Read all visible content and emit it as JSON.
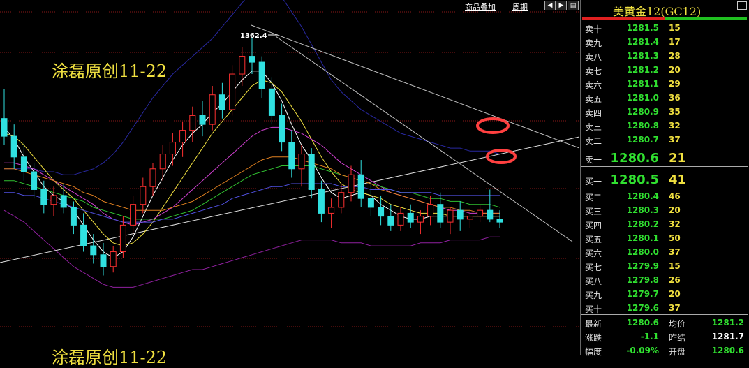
{
  "toolbar": {
    "overlay_label": "商品叠加",
    "period_label": "周期"
  },
  "watermark": {
    "top": "涂磊原创11-22",
    "bottom": "涂磊原创11-22"
  },
  "panel": {
    "title": "美黄金12(GC12)",
    "sell": [
      {
        "label": "卖十",
        "price": "1281.5",
        "qty": "15"
      },
      {
        "label": "卖九",
        "price": "1281.4",
        "qty": "17"
      },
      {
        "label": "卖八",
        "price": "1281.3",
        "qty": "28"
      },
      {
        "label": "卖七",
        "price": "1281.2",
        "qty": "20"
      },
      {
        "label": "卖六",
        "price": "1281.1",
        "qty": "29"
      },
      {
        "label": "卖五",
        "price": "1281.0",
        "qty": "36"
      },
      {
        "label": "卖四",
        "price": "1280.9",
        "qty": "35"
      },
      {
        "label": "卖三",
        "price": "1280.8",
        "qty": "32"
      },
      {
        "label": "卖二",
        "price": "1280.7",
        "qty": "37"
      },
      {
        "label": "卖一",
        "price": "1280.6",
        "qty": "21"
      }
    ],
    "buy": [
      {
        "label": "买一",
        "price": "1280.5",
        "qty": "41"
      },
      {
        "label": "买二",
        "price": "1280.4",
        "qty": "46"
      },
      {
        "label": "买三",
        "price": "1280.3",
        "qty": "20"
      },
      {
        "label": "买四",
        "price": "1280.2",
        "qty": "32"
      },
      {
        "label": "买五",
        "price": "1280.1",
        "qty": "50"
      },
      {
        "label": "买六",
        "price": "1280.0",
        "qty": "37"
      },
      {
        "label": "买七",
        "price": "1279.9",
        "qty": "15"
      },
      {
        "label": "买八",
        "price": "1279.8",
        "qty": "26"
      },
      {
        "label": "买九",
        "price": "1279.7",
        "qty": "20"
      },
      {
        "label": "买十",
        "price": "1279.6",
        "qty": "37"
      }
    ],
    "stats": {
      "latest_label": "最新",
      "latest": "1280.6",
      "avg_label": "均价",
      "avg": "1281.2",
      "change_label": "涨跌",
      "change": "-1.1",
      "prev_label": "昨结",
      "prev": "1281.7",
      "pct_label": "幅度",
      "pct": "-0.09%",
      "open_label": "开盘",
      "open": "1280.6"
    },
    "colors": {
      "price": "#30e030",
      "qty": "#f0e040",
      "neutral": "#ffffff"
    }
  },
  "chart_data": {
    "type": "line",
    "candles": [
      [
        1335,
        1345,
        1326,
        1329
      ],
      [
        1329,
        1333,
        1318,
        1322
      ],
      [
        1322,
        1327,
        1314,
        1317
      ],
      [
        1317,
        1320,
        1308,
        1311
      ],
      [
        1311,
        1314,
        1303,
        1306
      ],
      [
        1306,
        1312,
        1302,
        1309
      ],
      [
        1309,
        1313,
        1303,
        1305
      ],
      [
        1305,
        1307,
        1296,
        1299
      ],
      [
        1299,
        1303,
        1290,
        1292
      ],
      [
        1292,
        1296,
        1286,
        1289
      ],
      [
        1289,
        1293,
        1282,
        1285
      ],
      [
        1285,
        1292,
        1283,
        1290
      ],
      [
        1290,
        1302,
        1288,
        1299
      ],
      [
        1299,
        1309,
        1296,
        1306
      ],
      [
        1306,
        1315,
        1303,
        1312
      ],
      [
        1312,
        1320,
        1309,
        1318
      ],
      [
        1318,
        1326,
        1314,
        1323
      ],
      [
        1323,
        1330,
        1319,
        1327
      ],
      [
        1327,
        1334,
        1322,
        1331
      ],
      [
        1331,
        1339,
        1327,
        1336
      ],
      [
        1336,
        1341,
        1329,
        1333
      ],
      [
        1333,
        1346,
        1331,
        1343
      ],
      [
        1343,
        1347,
        1335,
        1338
      ],
      [
        1338,
        1353,
        1336,
        1350
      ],
      [
        1350,
        1359,
        1346,
        1356
      ],
      [
        1356,
        1362.4,
        1350,
        1354
      ],
      [
        1354,
        1356,
        1342,
        1345
      ],
      [
        1345,
        1349,
        1333,
        1336
      ],
      [
        1336,
        1340,
        1324,
        1327
      ],
      [
        1327,
        1331,
        1315,
        1318
      ],
      [
        1318,
        1326,
        1312,
        1323
      ],
      [
        1323,
        1325,
        1308,
        1311
      ],
      [
        1311,
        1314,
        1300,
        1303
      ],
      [
        1303,
        1308,
        1298,
        1305
      ],
      [
        1305,
        1313,
        1303,
        1310
      ],
      [
        1310,
        1319,
        1307,
        1316
      ],
      [
        1316,
        1321,
        1305,
        1308
      ],
      [
        1308,
        1313,
        1302,
        1305
      ],
      [
        1305,
        1309,
        1299,
        1302
      ],
      [
        1302,
        1306,
        1297,
        1299
      ],
      [
        1299,
        1305,
        1297,
        1303
      ],
      [
        1303,
        1306,
        1298,
        1300
      ],
      [
        1300,
        1304,
        1296,
        1302
      ],
      [
        1302,
        1309,
        1299,
        1306
      ],
      [
        1306,
        1310,
        1298,
        1300
      ],
      [
        1300,
        1305,
        1296,
        1304
      ],
      [
        1304,
        1307,
        1297,
        1301
      ],
      [
        1301,
        1304,
        1298,
        1302
      ],
      [
        1302,
        1306,
        1300,
        1304
      ],
      [
        1304,
        1311,
        1300,
        1301
      ],
      [
        1301,
        1304,
        1298,
        1300
      ]
    ],
    "ma_lines": [
      {
        "color": "#ffffff",
        "values": [
          1332,
          1328,
          1322,
          1317,
          1312,
          1309,
          1307,
          1304,
          1299,
          1294,
          1290,
          1288,
          1290,
          1295,
          1302,
          1309,
          1315,
          1321,
          1326,
          1330,
          1333,
          1337,
          1340,
          1344,
          1348,
          1351,
          1351,
          1347,
          1341,
          1333,
          1326,
          1321,
          1315,
          1310,
          1308,
          1309,
          1310,
          1309,
          1306,
          1304,
          1302,
          1301,
          1301,
          1302,
          1302,
          1302,
          1302,
          1302,
          1302,
          1302,
          1302
        ]
      },
      {
        "color": "#f0e040",
        "values": [
          1330,
          1329,
          1326,
          1322,
          1318,
          1314,
          1311,
          1308,
          1304,
          1300,
          1296,
          1293,
          1292,
          1293,
          1296,
          1300,
          1305,
          1310,
          1315,
          1320,
          1325,
          1330,
          1334,
          1338,
          1342,
          1346,
          1348,
          1347,
          1344,
          1339,
          1334,
          1328,
          1322,
          1317,
          1313,
          1311,
          1310,
          1309,
          1308,
          1306,
          1305,
          1304,
          1303,
          1303,
          1303,
          1302,
          1302,
          1302,
          1302,
          1302,
          1302
        ]
      },
      {
        "color": "#d040d0",
        "values": [
          1320,
          1320,
          1319,
          1318,
          1316,
          1314,
          1312,
          1310,
          1308,
          1306,
          1303,
          1301,
          1300,
          1299,
          1300,
          1301,
          1303,
          1305,
          1308,
          1311,
          1314,
          1317,
          1320,
          1323,
          1326,
          1329,
          1331,
          1332,
          1332,
          1331,
          1330,
          1328,
          1326,
          1323,
          1320,
          1318,
          1316,
          1314,
          1312,
          1310,
          1309,
          1308,
          1307,
          1306,
          1305,
          1304,
          1304,
          1303,
          1303,
          1303,
          1303
        ]
      },
      {
        "color": "#30c030",
        "values": [
          1314,
          1314,
          1313,
          1312,
          1311,
          1310,
          1309,
          1308,
          1307,
          1305,
          1304,
          1303,
          1302,
          1301,
          1301,
          1301,
          1301,
          1302,
          1303,
          1304,
          1306,
          1308,
          1310,
          1312,
          1314,
          1316,
          1317,
          1318,
          1319,
          1319,
          1319,
          1319,
          1318,
          1317,
          1316,
          1315,
          1314,
          1313,
          1312,
          1311,
          1310,
          1310,
          1309,
          1308,
          1308,
          1307,
          1307,
          1306,
          1306,
          1306,
          1305
        ]
      },
      {
        "color": "#e08020",
        "values": [
          1318,
          1318,
          1317,
          1316,
          1315,
          1314,
          1313,
          1312,
          1310,
          1309,
          1307,
          1306,
          1305,
          1304,
          1304,
          1304,
          1304,
          1305,
          1306,
          1307,
          1309,
          1311,
          1313,
          1315,
          1317,
          1319,
          1321,
          1322,
          1322,
          1322,
          1321,
          1320,
          1319,
          1318,
          1316,
          1315,
          1314,
          1313,
          1311,
          1310,
          1309,
          1308,
          1307,
          1306,
          1305,
          1305,
          1304,
          1304,
          1303,
          1303,
          1303
        ]
      },
      {
        "color": "#5050e0",
        "values": [
          1310,
          1310,
          1309,
          1309,
          1308,
          1307,
          1306,
          1305,
          1304,
          1303,
          1302,
          1301,
          1300,
          1300,
          1300,
          1300,
          1301,
          1301,
          1302,
          1303,
          1304,
          1305,
          1306,
          1308,
          1309,
          1310,
          1311,
          1312,
          1312,
          1313,
          1313,
          1313,
          1313,
          1313,
          1312,
          1312,
          1312,
          1311,
          1311,
          1311,
          1310,
          1310,
          1310,
          1310,
          1309,
          1309,
          1309,
          1309,
          1309,
          1309,
          1309
        ]
      }
    ],
    "band_upper": [
      1318,
      1318,
      1318,
      1318,
      1317,
      1317,
      1316,
      1316,
      1317,
      1318,
      1320,
      1323,
      1327,
      1332,
      1337,
      1342,
      1346,
      1350,
      1353,
      1356,
      1359,
      1362,
      1366,
      1370,
      1374,
      1378,
      1380,
      1379,
      1376,
      1371,
      1366,
      1360,
      1354,
      1348,
      1344,
      1341,
      1338,
      1336,
      1334,
      1332,
      1330,
      1329,
      1328,
      1327,
      1326,
      1325,
      1325,
      1324,
      1324,
      1324,
      1323
    ],
    "band_lower": [
      1304,
      1302,
      1300,
      1297,
      1294,
      1291,
      1288,
      1285,
      1283,
      1281,
      1279,
      1278,
      1278,
      1278,
      1279,
      1280,
      1281,
      1282,
      1283,
      1284,
      1284,
      1285,
      1286,
      1287,
      1288,
      1289,
      1290,
      1291,
      1292,
      1293,
      1294,
      1294,
      1294,
      1294,
      1293,
      1293,
      1293,
      1292,
      1292,
      1292,
      1292,
      1292,
      1293,
      1293,
      1293,
      1294,
      1294,
      1294,
      1294,
      1295,
      1295
    ],
    "annotations": [
      {
        "text": "1362.4"
      }
    ],
    "ylim": [
      1255,
      1375
    ]
  }
}
